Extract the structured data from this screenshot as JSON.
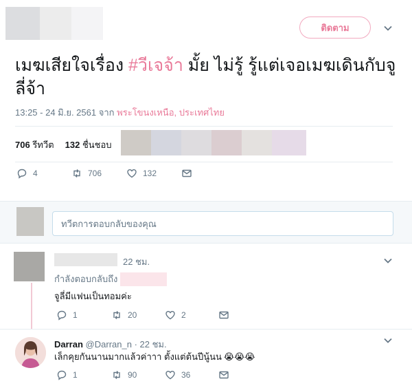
{
  "header": {
    "follow_label": "ติดตาม"
  },
  "tweet": {
    "text_before": "เมฆเสียใจเรื่อง ",
    "hashtag": "#วีเจจ้า",
    "text_after": " มั้ย ไม่รู้ รู้แต่เจอเมฆเดินกับจูลี่จ้า",
    "time": "13:25 - 24 มิ.ย. 2561",
    "from_label": "จาก",
    "location": "พระโขนงเหนือ, ประเทศไทย",
    "retweets_count": "706",
    "retweets_label": "รีทวีต",
    "likes_count": "132",
    "likes_label": "ชื่นชอบ",
    "actions": {
      "reply": "4",
      "retweet": "706",
      "like": "132"
    }
  },
  "reply_box": {
    "placeholder": "ทวีตการตอบกลับของคุณ"
  },
  "replies": [
    {
      "time": "22 ชม.",
      "replying_to": "กำลังตอบกลับถึง",
      "text": "จูลี่มีแฟนเป็นทอมค่ะ",
      "actions": {
        "reply": "1",
        "retweet": "20",
        "like": "2"
      }
    },
    {
      "name": "Darran",
      "handle": "@Darran_n",
      "time": "· 22 ชม.",
      "text": "เล็กคุยกันนานมากแล้วค่าาา ตั้งแต่ต้นปีนู้นน",
      "emoji": "😭😭😭",
      "actions": {
        "reply": "1",
        "retweet": "90",
        "like": "36"
      }
    }
  ],
  "colors": {
    "accent": "#e97a99",
    "muted": "#657786",
    "text": "#14171a"
  }
}
